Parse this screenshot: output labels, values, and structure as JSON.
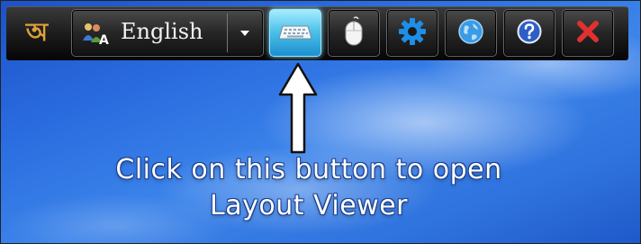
{
  "toolbar": {
    "logo_glyph": "অ",
    "language": {
      "selected": "English",
      "icon": "language-icon",
      "dropdown_icon": "chevron-down-icon"
    },
    "buttons": [
      {
        "name": "keyboard-layout-button",
        "icon": "keyboard-icon",
        "active": true
      },
      {
        "name": "mouse-button",
        "icon": "mouse-icon",
        "active": false
      },
      {
        "name": "settings-button",
        "icon": "gear-icon",
        "active": false
      },
      {
        "name": "web-button",
        "icon": "globe-icon",
        "active": false
      },
      {
        "name": "help-button",
        "icon": "help-icon",
        "active": false
      },
      {
        "name": "close-button",
        "icon": "close-icon",
        "active": false
      }
    ]
  },
  "annotation": {
    "line1": "Click on this button to open",
    "line2": "Layout Viewer"
  },
  "colors": {
    "toolbar_bg": "#1a1a1a",
    "active_button": "#4fc3ea",
    "logo": "#e0a23a",
    "close": "#e03030",
    "desktop_blue": "#2a6de0"
  }
}
